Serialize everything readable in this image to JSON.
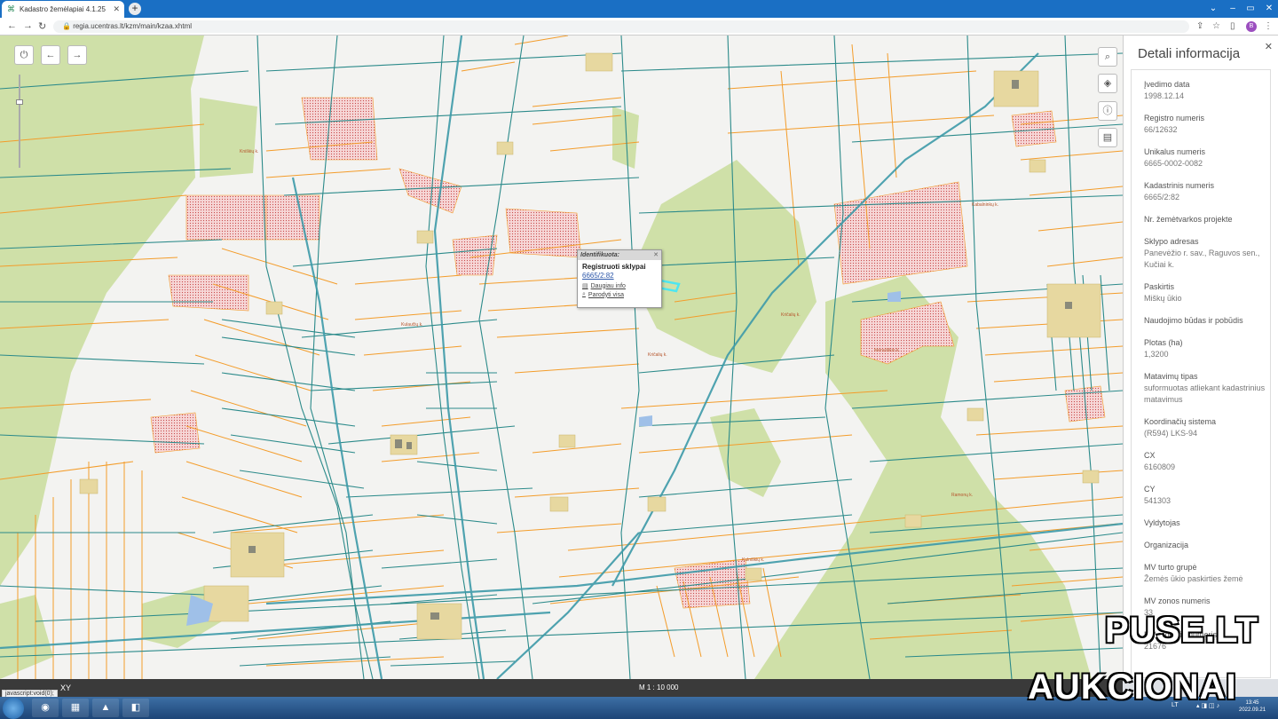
{
  "browser": {
    "tab_title": "Kadastro žemėlapiai 4.1.25",
    "url": "regia.ucentras.lt/kzm/main/kzaa.xhtml",
    "profile_initial": "B",
    "accent_color": "#1a6fc4"
  },
  "map": {
    "popup": {
      "header": "Identifikuota:",
      "title": "Registruoti sklypai",
      "parcel": "6665/2:82",
      "link_info": "Daugiau info",
      "link_show": "Parodyti visa"
    },
    "place_labels": [
      "Kniškių k.",
      "Kabalninkų k.",
      "Kričalių k.",
      "Kričalių k.",
      "Mėnuliškio k.",
      "Ramonų k.",
      "Kulaučių k.",
      "Kulniškių k."
    ],
    "scale": "M 1 : 10 000",
    "xy_label": "XY",
    "status_text": "javascript:void(0);",
    "colors": {
      "background": "#f3f3f1",
      "parcel_orange": "#f39c2a",
      "parcel_teal": "#2b8a8a",
      "forest": "#cfe0a8",
      "hatched": "#f3c3c3",
      "selected": "#4ee6f0"
    }
  },
  "panel": {
    "title": "Detali informacija",
    "fields": [
      {
        "key": "Įvedimo data",
        "value": "1998.12.14"
      },
      {
        "key": "Registro numeris",
        "value": "66/12632"
      },
      {
        "key": "Unikalus numeris",
        "value": "6665-0002-0082"
      },
      {
        "key": "Kadastrinis numeris",
        "value": "6665/2:82"
      },
      {
        "key": "Nr. žemėtvarkos projekte",
        "value": ""
      },
      {
        "key": "Sklypo adresas",
        "value": "Panevėžio r. sav., Raguvos sen., Kučiai k."
      },
      {
        "key": "Paskirtis",
        "value": "Miškų ūkio"
      },
      {
        "key": "Naudojimo būdas ir pobūdis",
        "value": ""
      },
      {
        "key": "Plotas (ha)",
        "value": "1,3200"
      },
      {
        "key": "Matavimų tipas",
        "value": "suformuotas atliekant kadastrinius matavimus"
      },
      {
        "key": "Koordinačių sistema",
        "value": "(R594) LKS-94"
      },
      {
        "key": "CX",
        "value": "6160809"
      },
      {
        "key": "CY",
        "value": "541303"
      },
      {
        "key": "Vyldytojas",
        "value": ""
      },
      {
        "key": "Organizacija",
        "value": ""
      },
      {
        "key": "MV turto grupė",
        "value": "Žemės ūkio paskirties žemė"
      },
      {
        "key": "MV zonos numeris",
        "value": "33"
      },
      {
        "key": "MV modelio numeris",
        "value": "21676"
      }
    ]
  },
  "taskbar": {
    "lang": "LT",
    "time": "13:45",
    "date": "2022.09.21"
  },
  "watermark": {
    "line1": "PUSE.LT",
    "line2": "AUKCIONAI"
  }
}
